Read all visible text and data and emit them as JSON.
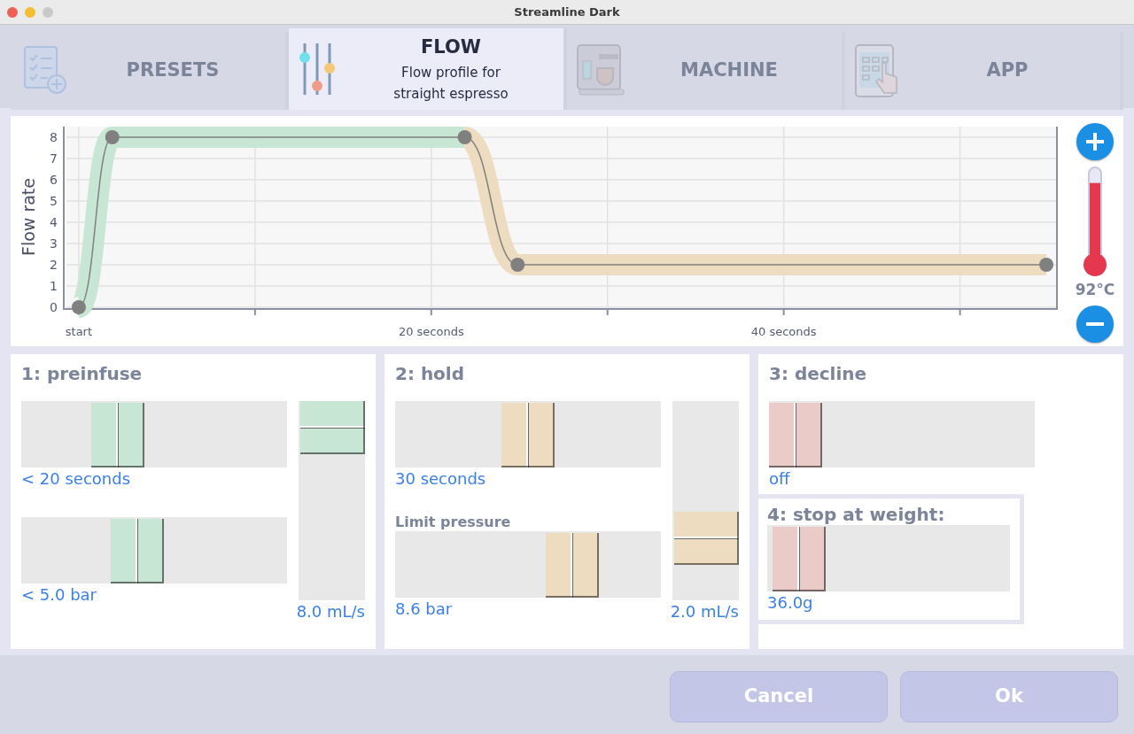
{
  "window": {
    "title": "Streamline Dark"
  },
  "tabs": [
    {
      "label": "PRESETS",
      "selected": false
    },
    {
      "label": "FLOW",
      "subtitle": "Flow profile for straight espresso",
      "selected": true
    },
    {
      "label": "MACHINE",
      "selected": false
    },
    {
      "label": "APP",
      "selected": false
    }
  ],
  "chart": {
    "chart_data": {
      "type": "line",
      "ylabel": "Flow rate",
      "x": [
        0,
        1.9,
        21.9,
        24.9,
        54.9
      ],
      "series": [
        {
          "color": "#c8e6d4",
          "values": [
            0,
            8,
            8,
            null,
            null
          ]
        },
        {
          "color": "#eddcbf",
          "values": [
            null,
            null,
            8,
            2,
            2
          ]
        },
        {
          "color": "#808080",
          "marker": "circle",
          "values": [
            0,
            8,
            8,
            2,
            2
          ]
        }
      ],
      "grid": true,
      "xlim": [
        -0.7,
        55.5
      ],
      "ylim": [
        0,
        8.5
      ],
      "xticks": [
        {
          "value": 0,
          "label": "start"
        },
        {
          "value": 20,
          "label": "20 seconds"
        },
        {
          "value": 40,
          "label": "40 seconds"
        }
      ],
      "yticks": [
        0,
        1,
        2,
        3,
        4,
        5,
        6,
        7,
        8
      ]
    },
    "temperature": {
      "reading": "92°C",
      "level": 0.83
    }
  },
  "steps": [
    {
      "title": "1: preinfuse",
      "color": "#c8e6d4",
      "sliders": [
        {
          "kind": "horizontal",
          "level": 0.33,
          "reading": "< 20 seconds"
        },
        {
          "kind": "horizontal",
          "level": 0.42,
          "reading": "< 5.0 bar"
        },
        {
          "kind": "vertical",
          "level": 1,
          "reading": "8.0 mL/s"
        }
      ]
    },
    {
      "title": "2: hold",
      "color": "#eddcbf",
      "sliders": [
        {
          "kind": "horizontal",
          "level": 0.5,
          "reading": "30 seconds"
        },
        {
          "kind": "horizontal",
          "label": "Limit pressure",
          "level": 0.71,
          "reading": "8.6 bar"
        },
        {
          "kind": "vertical",
          "level": 0.24,
          "reading": "2.0 mL/s"
        }
      ]
    },
    {
      "title": "3: decline",
      "color": "#ebcbc8",
      "sliders": [
        {
          "kind": "horizontal",
          "level": 0,
          "reading": "off"
        }
      ]
    },
    {
      "title": "4: stop at weight:",
      "color": "#ebcbc8",
      "sliders": [
        {
          "kind": "horizontal",
          "level": 0.03,
          "reading": "36.0g"
        }
      ]
    }
  ],
  "buttons": [
    {
      "label": "Cancel"
    },
    {
      "label": "Ok"
    }
  ]
}
